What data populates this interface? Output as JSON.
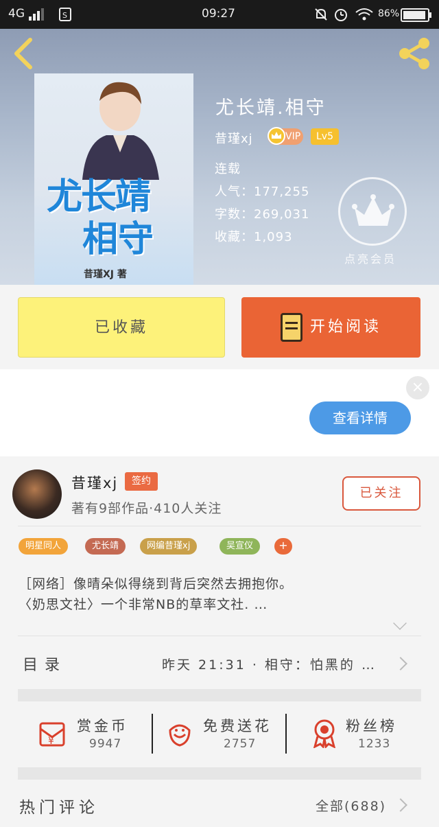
{
  "status_bar": {
    "network": "4G",
    "time": "09:27",
    "battery": "86%"
  },
  "book": {
    "cover_title_line1": "尤长靖",
    "cover_title_line2": "相守",
    "cover_author": "昔瑾XJ 著",
    "title": "尤长靖.相守",
    "author": "昔瑾xj",
    "vip_label": "VIP",
    "level_label": "Lv5",
    "status": "连载",
    "popularity": "人气：177,255",
    "word_count": "字数：269,031",
    "favorites": "收藏：1,093",
    "member_label": "点亮会员"
  },
  "actions": {
    "favorited_label": "已收藏",
    "start_reading_label": "开始阅读"
  },
  "ad": {
    "close_glyph": "×",
    "detail_button": "查看详情"
  },
  "author_section": {
    "name": "昔瑾xj",
    "signed_badge": "签约",
    "info": "著有9部作品·410人关注",
    "follow_button": "已关注"
  },
  "tags": [
    {
      "label": "明星同人",
      "color": "#f2a43a"
    },
    {
      "label": "尤长靖",
      "color": "#c46a53"
    },
    {
      "label": "网编昔瑾xj",
      "color": "#c9a04a"
    },
    {
      "label": "吴宣仪",
      "color": "#8fb55a"
    }
  ],
  "tag_more": "+",
  "description": {
    "line1": "［网络］像晴朵似得绕到背后突然去拥抱你。",
    "line2": "〈奶思文社〉一个非常NB的草率文社. …"
  },
  "toc": {
    "label": "目录",
    "latest": "昨天 21:31 · 相守：怕黑的 …"
  },
  "stats": [
    {
      "label": "赏金币",
      "value": "9947",
      "icon": "red-envelope-icon"
    },
    {
      "label": "免费送花",
      "value": "2757",
      "icon": "flower-icon"
    },
    {
      "label": "粉丝榜",
      "value": "1233",
      "icon": "medal-icon"
    }
  ],
  "comments": {
    "label": "热门评论",
    "all_label": "全部(688)"
  }
}
